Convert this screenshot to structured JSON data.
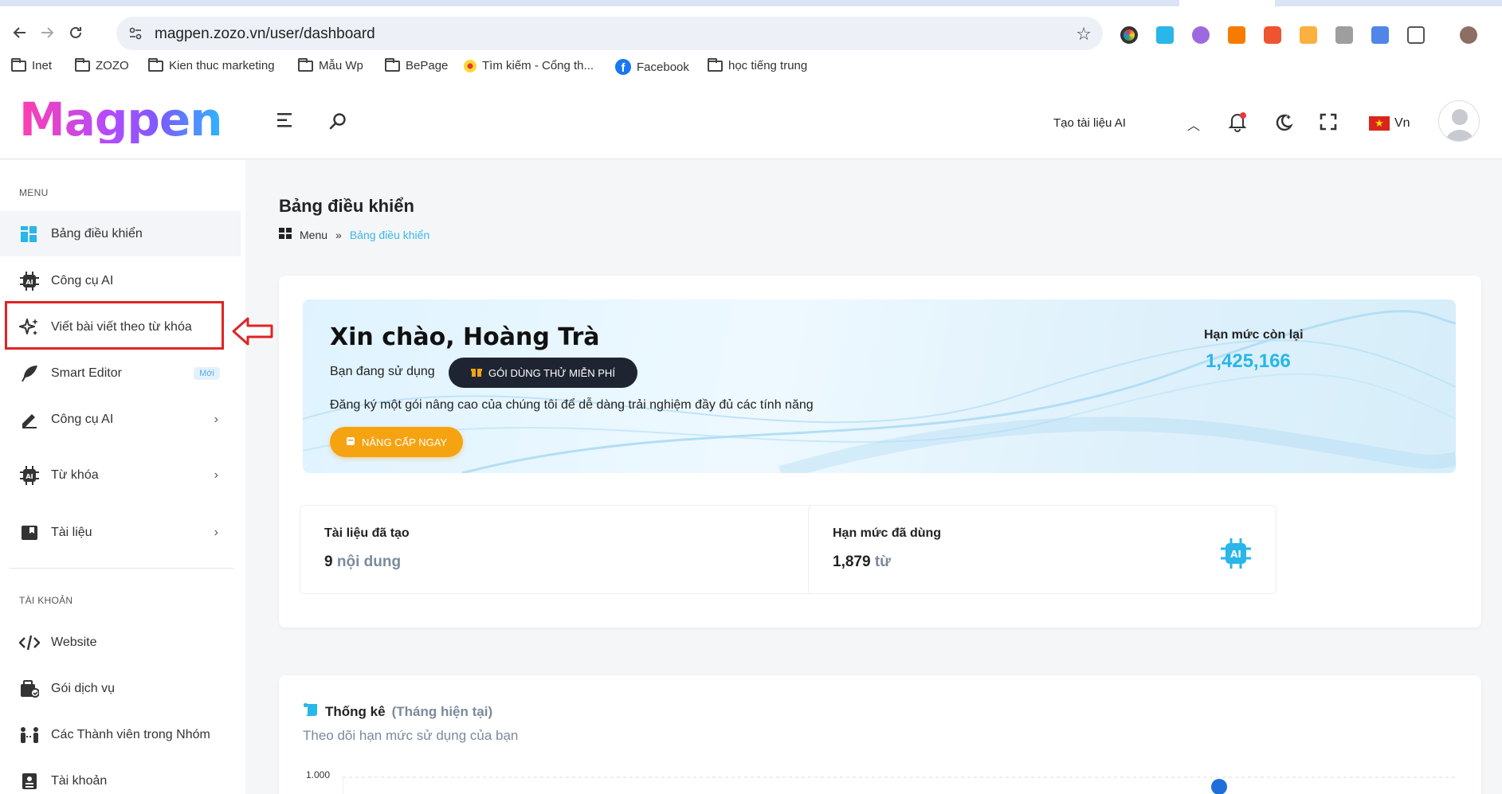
{
  "browser": {
    "url": "magpen.zozo.vn/user/dashboard",
    "bookmarks": [
      {
        "label": "Inet",
        "icon": "folder-icon"
      },
      {
        "label": "ZOZO",
        "icon": "folder-icon"
      },
      {
        "label": "Kien thuc marketing",
        "icon": "folder-icon"
      },
      {
        "label": "Mẫu Wp",
        "icon": "folder-icon"
      },
      {
        "label": "BePage",
        "icon": "folder-icon"
      },
      {
        "label": "Tìm kiếm - Cổng th...",
        "icon": "site-icon"
      },
      {
        "label": "Facebook",
        "icon": "facebook-icon"
      },
      {
        "label": "học tiếng trung",
        "icon": "folder-icon"
      }
    ]
  },
  "header": {
    "brand": "Magpen",
    "tool_select": "Tạo tài liệu AI",
    "language": "Vn"
  },
  "sidebar": {
    "menu_title": "MENU",
    "items": [
      {
        "label": "Bảng điều khiển",
        "icon": "dashboard-icon"
      },
      {
        "label": "Công cụ AI",
        "icon": "ai-chip-icon"
      },
      {
        "label": "Viết bài viết theo từ khóa",
        "icon": "sparkles-icon"
      },
      {
        "label": "Smart Editor",
        "icon": "feather-icon",
        "badge": "Mới"
      },
      {
        "label": "Công cụ AI",
        "icon": "pencil-icon"
      },
      {
        "label": "Từ khóa",
        "icon": "ai-chip-icon"
      },
      {
        "label": "Tài liệu",
        "icon": "bookmark-folder-icon"
      }
    ],
    "account_title": "TÀI KHOẢN",
    "account_items": [
      {
        "label": "Website",
        "icon": "code-icon"
      },
      {
        "label": "Gói dịch vụ",
        "icon": "package-icon"
      },
      {
        "label": "Các Thành viên trong Nhóm",
        "icon": "team-icon"
      },
      {
        "label": "Tài khoản",
        "icon": "id-card-icon"
      }
    ]
  },
  "main": {
    "page_title": "Bảng điều khiển",
    "breadcrumb": {
      "root": "Menu",
      "separator": "»",
      "current": "Bảng điều khiển"
    },
    "welcome": {
      "greeting": "Xin chào, Hoàng Trà",
      "using_text": "Bạn đang sử dụng",
      "plan_button": "GÓI DÙNG THỬ MIỄN PHÍ",
      "register_text": "Đăng ký một gói nâng cao của chúng tôi để dễ dàng trải nghiệm đầy đủ các tính năng",
      "upgrade_button": "NÂNG CẤP NGAY",
      "quota_label": "Hạn mức còn lại",
      "quota_value": "1,425,166"
    },
    "stats": [
      {
        "label": "Tài liệu đã tạo",
        "number": "9",
        "unit": "nội dung",
        "icon": "folder-dots-icon"
      },
      {
        "label": "Hạn mức đã dùng",
        "number": "1,879",
        "unit": "từ",
        "icon": "ai-chip-icon"
      }
    ],
    "statistics": {
      "title": "Thống kê",
      "title_suffix": "(Tháng hiện tại)",
      "description": "Theo dõi hạn mức sử dụng của bạn",
      "y_tick_top": "1.000"
    }
  },
  "colors": {
    "accent": "#29b6e8",
    "dark_button": "#1f2433",
    "upgrade": "#f6a312",
    "highlight": "#e02424"
  }
}
